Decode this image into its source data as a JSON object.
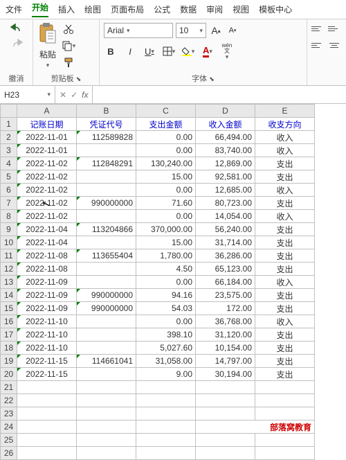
{
  "menu": {
    "file": "文件",
    "home": "开始",
    "insert": "插入",
    "draw": "绘图",
    "layout": "页面布局",
    "formula": "公式",
    "data": "数据",
    "review": "审阅",
    "view": "视图",
    "template": "模板中心"
  },
  "ribbon": {
    "undo_group": "撤消",
    "paste_label": "粘贴",
    "clipboard_group": "剪贴板",
    "font_name": "Arial",
    "font_size": "10",
    "font_group": "字体",
    "bold": "B",
    "italic": "I",
    "underline": "U",
    "wen": "wén",
    "wen2": "文"
  },
  "namebox": {
    "cell": "H23",
    "fx": "fx"
  },
  "cols": [
    "A",
    "B",
    "C",
    "D",
    "E"
  ],
  "headers": {
    "date": "记账日期",
    "voucher": "凭证代号",
    "out": "支出金额",
    "in": "收入金额",
    "dir": "收支方向"
  },
  "rows": [
    {
      "r": 2,
      "date": "2022-11-01",
      "voucher": "112589828",
      "out": "0.00",
      "in": "66,494.00",
      "dir": "收入"
    },
    {
      "r": 3,
      "date": "2022-11-01",
      "voucher": "",
      "out": "0.00",
      "in": "83,740.00",
      "dir": "收入"
    },
    {
      "r": 4,
      "date": "2022-11-02",
      "voucher": "112848291",
      "out": "130,240.00",
      "in": "12,869.00",
      "dir": "支出"
    },
    {
      "r": 5,
      "date": "2022-11-02",
      "voucher": "",
      "out": "15.00",
      "in": "92,581.00",
      "dir": "支出"
    },
    {
      "r": 6,
      "date": "2022-11-02",
      "voucher": "",
      "out": "0.00",
      "in": "12,685.00",
      "dir": "收入"
    },
    {
      "r": 7,
      "date": "2022-11-02",
      "voucher": "990000000",
      "out": "71.60",
      "in": "80,723.00",
      "dir": "支出"
    },
    {
      "r": 8,
      "date": "2022-11-02",
      "voucher": "",
      "out": "0.00",
      "in": "14,054.00",
      "dir": "收入"
    },
    {
      "r": 9,
      "date": "2022-11-04",
      "voucher": "113204866",
      "out": "370,000.00",
      "in": "56,240.00",
      "dir": "支出"
    },
    {
      "r": 10,
      "date": "2022-11-04",
      "voucher": "",
      "out": "15.00",
      "in": "31,714.00",
      "dir": "支出"
    },
    {
      "r": 11,
      "date": "2022-11-08",
      "voucher": "113655404",
      "out": "1,780.00",
      "in": "36,286.00",
      "dir": "支出"
    },
    {
      "r": 12,
      "date": "2022-11-08",
      "voucher": "",
      "out": "4.50",
      "in": "65,123.00",
      "dir": "支出"
    },
    {
      "r": 13,
      "date": "2022-11-09",
      "voucher": "",
      "out": "0.00",
      "in": "66,184.00",
      "dir": "收入"
    },
    {
      "r": 14,
      "date": "2022-11-09",
      "voucher": "990000000",
      "out": "94.16",
      "in": "23,575.00",
      "dir": "支出"
    },
    {
      "r": 15,
      "date": "2022-11-09",
      "voucher": "990000000",
      "out": "54.03",
      "in": "172.00",
      "dir": "支出"
    },
    {
      "r": 16,
      "date": "2022-11-10",
      "voucher": "",
      "out": "0.00",
      "in": "36,768.00",
      "dir": "收入"
    },
    {
      "r": 17,
      "date": "2022-11-10",
      "voucher": "",
      "out": "398.10",
      "in": "31,120.00",
      "dir": "支出"
    },
    {
      "r": 18,
      "date": "2022-11-10",
      "voucher": "",
      "out": "5,027.60",
      "in": "10,154.00",
      "dir": "支出"
    },
    {
      "r": 19,
      "date": "2022-11-15",
      "voucher": "114661041",
      "out": "31,058.00",
      "in": "14,797.00",
      "dir": "支出"
    },
    {
      "r": 20,
      "date": "2022-11-15",
      "voucher": "",
      "out": "9.00",
      "in": "30,194.00",
      "dir": "支出"
    }
  ],
  "empty_rows": [
    21,
    22,
    23,
    24,
    25,
    26
  ],
  "watermark": "部落窝教育"
}
